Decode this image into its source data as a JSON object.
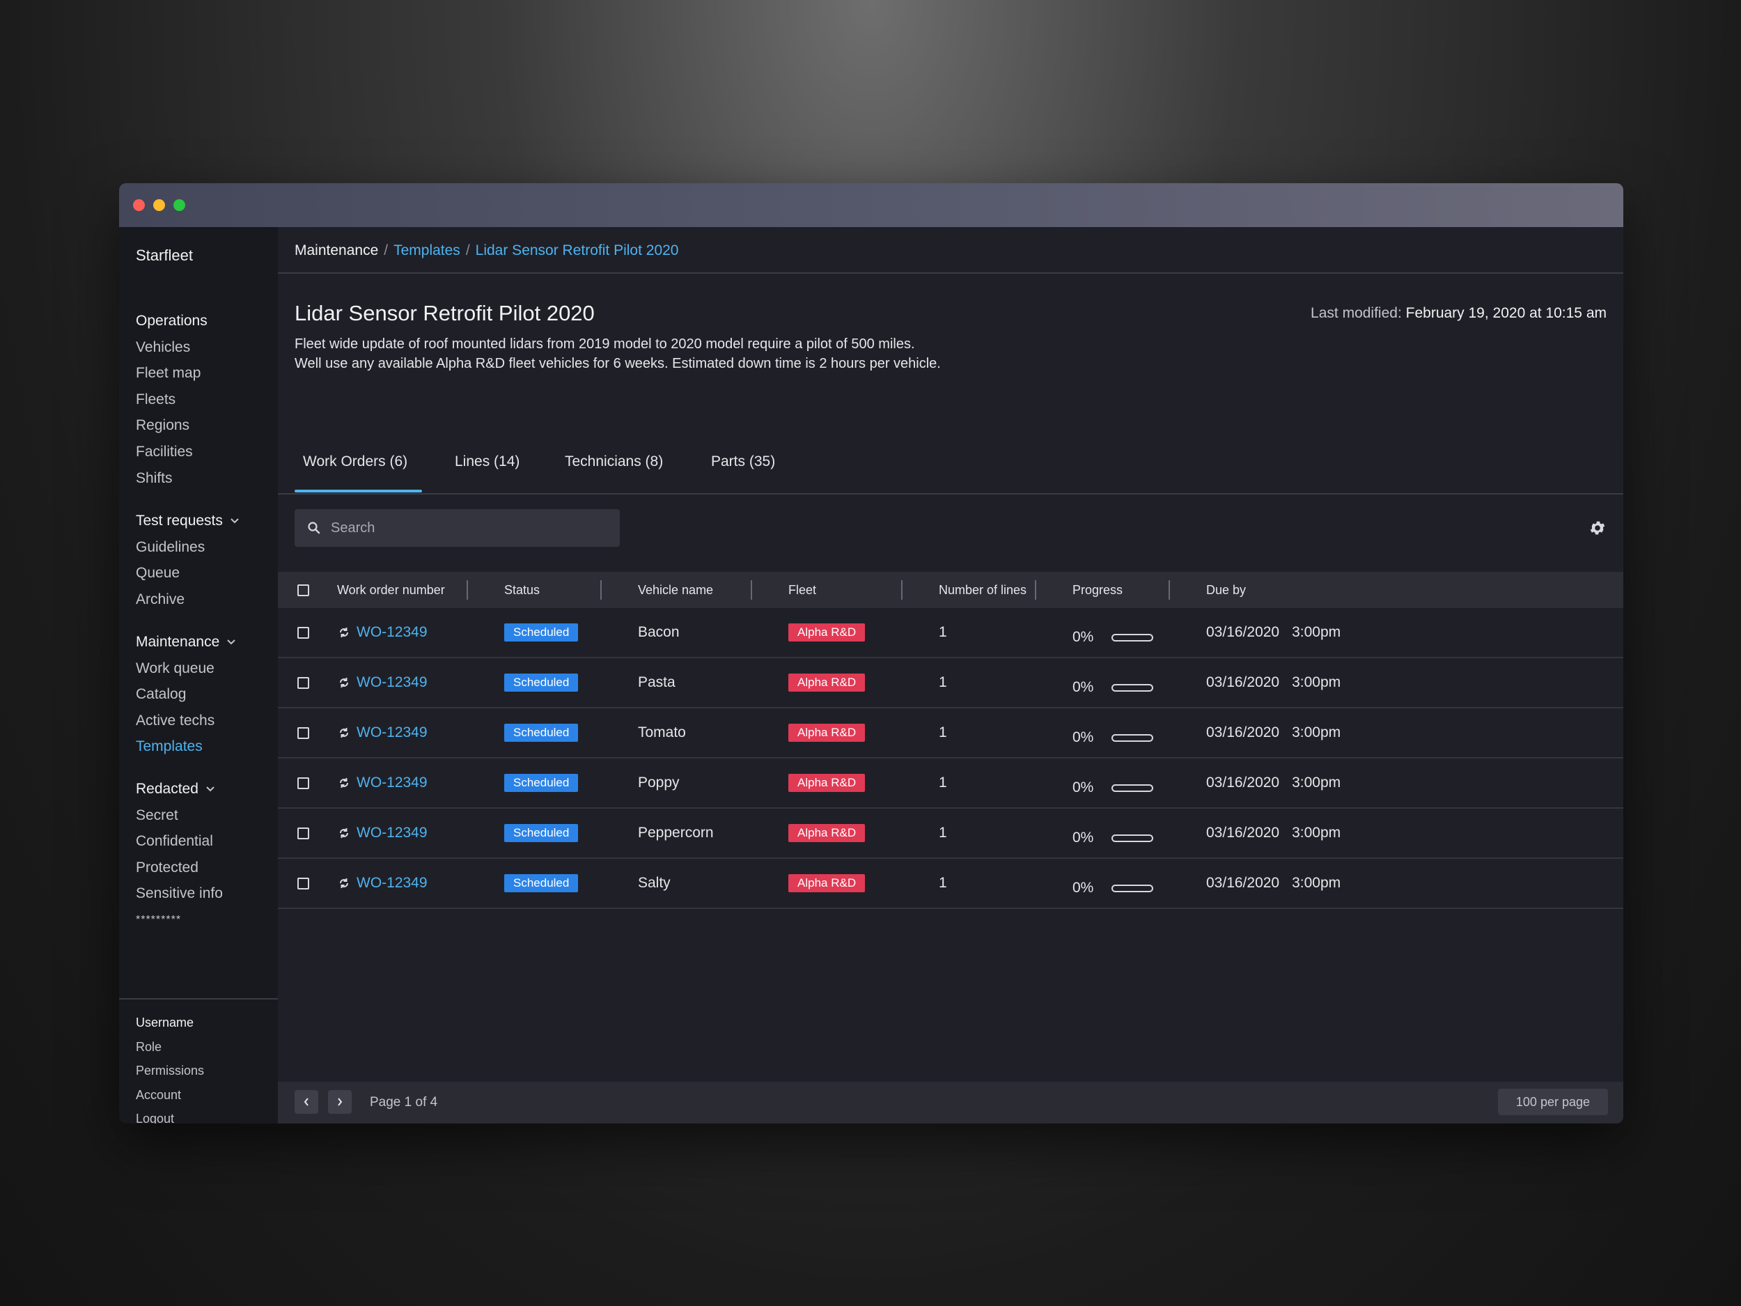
{
  "app": {
    "brand": "Starfleet"
  },
  "sidebar": {
    "groups": [
      {
        "head": "Operations",
        "items": [
          "Vehicles",
          "Fleet map",
          "Fleets",
          "Regions",
          "Facilities",
          "Shifts"
        ]
      },
      {
        "head": "Test requests",
        "items": [
          "Guidelines",
          "Queue",
          "Archive"
        ]
      },
      {
        "head": "Maintenance",
        "items": [
          "Work queue",
          "Catalog",
          "Active techs",
          "Templates"
        ]
      },
      {
        "head": "Redacted",
        "items": [
          "Secret",
          "Confidential",
          "Protected",
          "Sensitive info",
          "*********"
        ]
      }
    ],
    "active_item": "Templates",
    "user": {
      "head": "Username",
      "items": [
        "Role",
        "Permissions",
        "Account",
        "Logout"
      ]
    }
  },
  "breadcrumb": {
    "root": "Maintenance",
    "sep": "/",
    "templates": "Templates",
    "current": "Lidar Sensor Retrofit Pilot 2020"
  },
  "page": {
    "title": "Lidar Sensor Retrofit Pilot 2020",
    "modified_label": "Last modified:",
    "modified_value": "February 19, 2020 at 10:15 am",
    "desc_line1": "Fleet wide update of roof mounted lidars from 2019 model to 2020 model require a pilot of 500 miles.",
    "desc_line2": "Well use any available Alpha R&D fleet vehicles for 6 weeks. Estimated down time is 2 hours per vehicle."
  },
  "tabs": [
    "Work Orders (6)",
    "Lines (14)",
    "Technicians (8)",
    "Parts (35)"
  ],
  "search": {
    "placeholder": "Search"
  },
  "table": {
    "headers": [
      "Work order number",
      "Status",
      "Vehicle name",
      "Fleet",
      "Number of lines",
      "Progress",
      "Due by"
    ],
    "rows": [
      {
        "wo": "WO-12349",
        "status": "Scheduled",
        "vehicle": "Bacon",
        "fleet": "Alpha R&D",
        "lines": "1",
        "progress": "0%",
        "progress_value": 0,
        "date": "03/16/2020",
        "time": "3:00pm"
      },
      {
        "wo": "WO-12349",
        "status": "Scheduled",
        "vehicle": "Pasta",
        "fleet": "Alpha R&D",
        "lines": "1",
        "progress": "0%",
        "progress_value": 0,
        "date": "03/16/2020",
        "time": "3:00pm"
      },
      {
        "wo": "WO-12349",
        "status": "Scheduled",
        "vehicle": "Tomato",
        "fleet": "Alpha R&D",
        "lines": "1",
        "progress": "0%",
        "progress_value": 0,
        "date": "03/16/2020",
        "time": "3:00pm"
      },
      {
        "wo": "WO-12349",
        "status": "Scheduled",
        "vehicle": "Poppy",
        "fleet": "Alpha R&D",
        "lines": "1",
        "progress": "0%",
        "progress_value": 0,
        "date": "03/16/2020",
        "time": "3:00pm"
      },
      {
        "wo": "WO-12349",
        "status": "Scheduled",
        "vehicle": "Peppercorn",
        "fleet": "Alpha R&D",
        "lines": "1",
        "progress": "0%",
        "progress_value": 0,
        "date": "03/16/2020",
        "time": "3:00pm"
      },
      {
        "wo": "WO-12349",
        "status": "Scheduled",
        "vehicle": "Salty",
        "fleet": "Alpha R&D",
        "lines": "1",
        "progress": "0%",
        "progress_value": 0,
        "date": "03/16/2020",
        "time": "3:00pm"
      }
    ]
  },
  "pagination": {
    "page_text": "Page 1 of 4",
    "per_page": "100 per page",
    "prev_icon": "chevron-left-icon",
    "next_icon": "chevron-right-icon"
  },
  "colors": {
    "accent": "#4fb3f0",
    "status_scheduled": "#2b83e8",
    "fleet_badge": "#e03a55",
    "background": "#1f2027"
  }
}
